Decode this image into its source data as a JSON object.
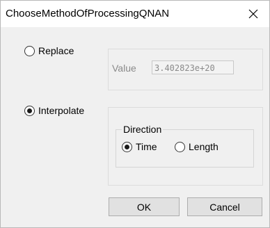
{
  "window": {
    "title": "ChooseMethodOfProcessingQNAN"
  },
  "replace": {
    "label": "Replace",
    "checked": false,
    "value_label": "Value",
    "value": "3.402823e+20"
  },
  "interpolate": {
    "label": "Interpolate",
    "checked": true,
    "direction": {
      "group_label": "Direction",
      "options": [
        {
          "label": "Time",
          "checked": true
        },
        {
          "label": "Length",
          "checked": false
        }
      ]
    }
  },
  "buttons": {
    "ok_label": "OK",
    "cancel_label": "Cancel"
  },
  "icons": {
    "close": "close-icon"
  }
}
